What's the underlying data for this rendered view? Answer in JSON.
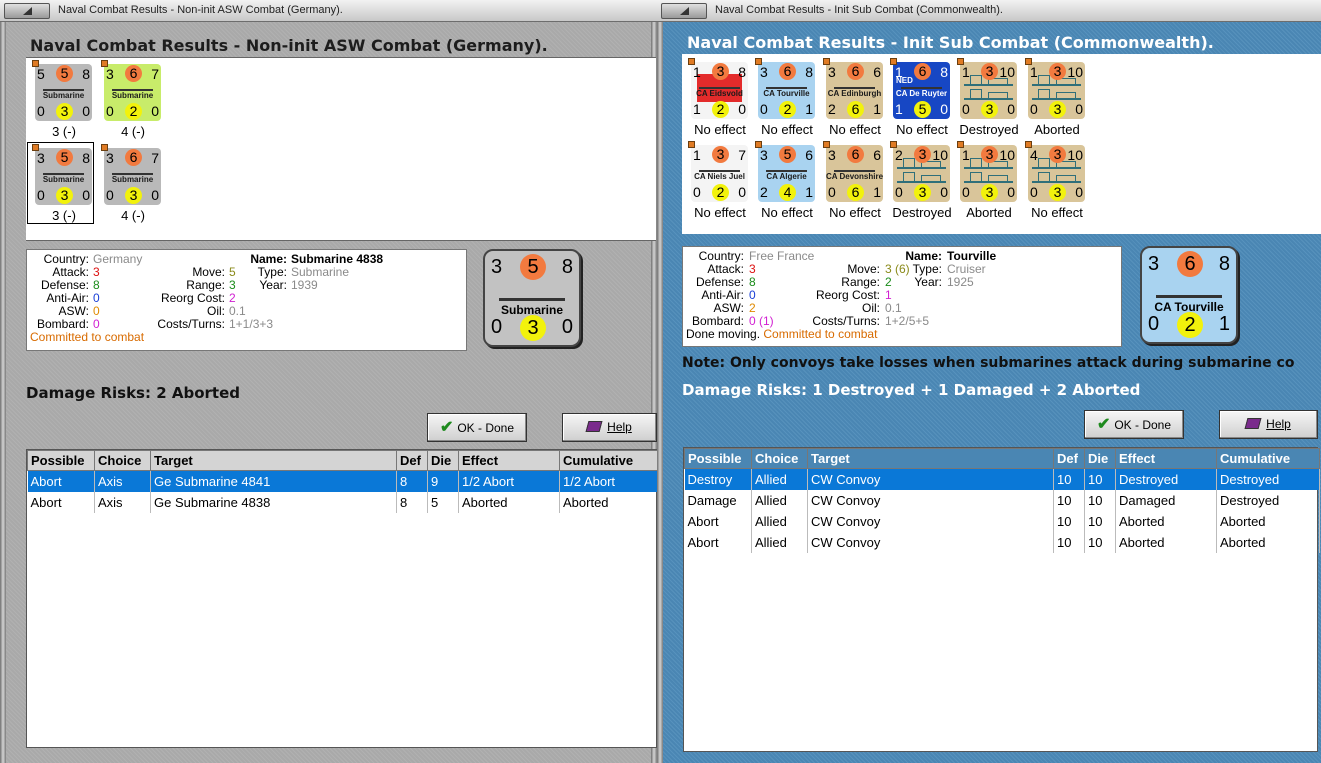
{
  "left": {
    "window_title": "Naval Combat Results - Non-init ASW Combat (Germany).",
    "heading": "Naval Combat Results - Non-init ASW Combat (Germany).",
    "units": [
      {
        "tl": "5",
        "tc": "5",
        "tr": "8",
        "name": "Submarine",
        "bl": "0",
        "bc": "3",
        "br": "0",
        "result": "3 (-)",
        "bg": "#b9b9b9"
      },
      {
        "tl": "3",
        "tc": "6",
        "tr": "7",
        "name": "Submarine",
        "bl": "0",
        "bc": "2",
        "br": "0",
        "result": "4 (-)",
        "bg": "#c8ec6a"
      },
      {
        "tl": "3",
        "tc": "5",
        "tr": "8",
        "name": "Submarine",
        "bl": "0",
        "bc": "3",
        "br": "0",
        "result": "3 (-)",
        "bg": "#b9b9b9"
      },
      {
        "tl": "3",
        "tc": "6",
        "tr": "7",
        "name": "Submarine",
        "bl": "0",
        "bc": "3",
        "br": "0",
        "result": "4 (-)",
        "bg": "#b9b9b9"
      }
    ],
    "info": {
      "country_label": "Country:",
      "country": "Germany",
      "attack_label": "Attack:",
      "attack": "3",
      "defense_label": "Defense:",
      "defense": "8",
      "antiair_label": "Anti-Air:",
      "antiair": "0",
      "asw_label": "ASW:",
      "asw": "0",
      "bombard_label": "Bombard:",
      "bombard": "0",
      "move_label": "Move:",
      "move": "5",
      "range_label": "Range:",
      "range": "3",
      "reorg_label": "Reorg Cost:",
      "reorg": "2",
      "oil_label": "Oil:",
      "oil": "0.1",
      "costs_label": "Costs/Turns:",
      "costs": "1+1/3+3",
      "name_label": "Name:",
      "name": "Submarine 4838",
      "type_label": "Type:",
      "type": "Submarine",
      "year_label": "Year:",
      "year": "1939",
      "status": "Committed to combat"
    },
    "big": {
      "tl": "3",
      "tc": "5",
      "tr": "8",
      "name": "Submarine",
      "bl": "0",
      "bc": "3",
      "br": "0"
    },
    "damage_risks": "Damage Risks:  2 Aborted",
    "ok_label": "OK - Done",
    "help_label": "Help",
    "columns": [
      "Possible",
      "Choice",
      "Target",
      "Def",
      "Die",
      "Effect",
      "Cumulative"
    ],
    "rows": [
      [
        "Abort",
        "Axis",
        "Ge Submarine 4841",
        "8",
        "9",
        "1/2 Abort",
        "1/2 Abort"
      ],
      [
        "Abort",
        "Axis",
        "Ge Submarine 4838",
        "8",
        "5",
        "Aborted",
        "Aborted"
      ]
    ]
  },
  "right": {
    "window_title": "Naval Combat Results - Init Sub Combat (Commonwealth).",
    "heading": "Naval Combat Results - Init Sub Combat (Commonwealth).",
    "units": [
      {
        "tl": "1",
        "tc": "3",
        "tr": "8",
        "name": "CA Eidsvold",
        "bl": "1",
        "bc": "2",
        "br": "0",
        "result": "No effect",
        "bg": "#f4f4f4",
        "special": "red"
      },
      {
        "tl": "3",
        "tc": "6",
        "tr": "8",
        "name": "CA Tourville",
        "bl": "0",
        "bc": "2",
        "br": "1",
        "result": "No effect",
        "bg": "#a9d3f0"
      },
      {
        "tl": "3",
        "tc": "6",
        "tr": "6",
        "name": "CA Edinburgh",
        "bl": "2",
        "bc": "6",
        "br": "1",
        "result": "No effect",
        "bg": "#d9c59a"
      },
      {
        "tl": "1",
        "tc": "6",
        "tr": "8",
        "name": "CA De Ruyter",
        "bl": "1",
        "bc": "5",
        "br": "0",
        "result": "No effect",
        "bg": "#1747c4",
        "nat": "NED"
      },
      {
        "tl": "1",
        "tc": "3",
        "tr": "10",
        "name": "",
        "bl": "0",
        "bc": "3",
        "br": "0",
        "result": "Destroyed",
        "bg": "#d9c59a",
        "convoy": true
      },
      {
        "tl": "1",
        "tc": "3",
        "tr": "10",
        "name": "",
        "bl": "0",
        "bc": "3",
        "br": "0",
        "result": "Aborted",
        "bg": "#d9c59a",
        "convoy": true
      },
      {
        "tl": "1",
        "tc": "3",
        "tr": "7",
        "name": "CA Niels Juel",
        "bl": "0",
        "bc": "2",
        "br": "0",
        "result": "No effect",
        "bg": "#f4f4f4"
      },
      {
        "tl": "3",
        "tc": "5",
        "tr": "6",
        "name": "CA Algerie",
        "bl": "2",
        "bc": "4",
        "br": "1",
        "result": "No effect",
        "bg": "#a9d3f0"
      },
      {
        "tl": "3",
        "tc": "6",
        "tr": "6",
        "name": "CA Devonshire",
        "bl": "0",
        "bc": "6",
        "br": "1",
        "result": "No effect",
        "bg": "#d9c59a"
      },
      {
        "tl": "2",
        "tc": "3",
        "tr": "10",
        "name": "",
        "bl": "0",
        "bc": "3",
        "br": "0",
        "result": "Destroyed",
        "bg": "#d9c59a",
        "convoy": true
      },
      {
        "tl": "1",
        "tc": "3",
        "tr": "10",
        "name": "",
        "bl": "0",
        "bc": "3",
        "br": "0",
        "result": "Aborted",
        "bg": "#d9c59a",
        "convoy": true
      },
      {
        "tl": "4",
        "tc": "3",
        "tr": "10",
        "name": "",
        "bl": "0",
        "bc": "3",
        "br": "0",
        "result": "No effect",
        "bg": "#d9c59a",
        "convoy": true
      }
    ],
    "info": {
      "country_label": "Country:",
      "country": "Free France",
      "attack_label": "Attack:",
      "attack": "3",
      "defense_label": "Defense:",
      "defense": "8",
      "antiair_label": "Anti-Air:",
      "antiair": "0",
      "asw_label": "ASW:",
      "asw": "2",
      "bombard_label": "Bombard:",
      "bombard": "0 (1)",
      "move_label": "Move:",
      "move": "3 (6)",
      "range_label": "Range:",
      "range": "2",
      "reorg_label": "Reorg Cost:",
      "reorg": "1",
      "oil_label": "Oil:",
      "oil": "0.1",
      "costs_label": "Costs/Turns:",
      "costs": "1+2/5+5",
      "name_label": "Name:",
      "name": "Tourville",
      "type_label": "Type:",
      "type": "Cruiser",
      "year_label": "Year:",
      "year": "1925",
      "status_prefix": "Done moving. ",
      "status": "Committed to combat"
    },
    "big": {
      "tl": "3",
      "tc": "6",
      "tr": "8",
      "name": "CA Tourville",
      "bl": "0",
      "bc": "2",
      "br": "1"
    },
    "note": "Note: Only convoys take losses when submarines attack during submarine co",
    "damage_risks": "Damage Risks:  1 Destroyed + 1 Damaged + 2 Aborted",
    "ok_label": "OK - Done",
    "help_label": "Help",
    "columns": [
      "Possible",
      "Choice",
      "Target",
      "Def",
      "Die",
      "Effect",
      "Cumulative"
    ],
    "rows": [
      [
        "Destroy",
        "Allied",
        "CW Convoy",
        "10",
        "10",
        "Destroyed",
        "Destroyed"
      ],
      [
        "Damage",
        "Allied",
        "CW Convoy",
        "10",
        "10",
        "Damaged",
        "Destroyed"
      ],
      [
        "Abort",
        "Allied",
        "CW Convoy",
        "10",
        "10",
        "Aborted",
        "Aborted"
      ],
      [
        "Abort",
        "Allied",
        "CW Convoy",
        "10",
        "10",
        "Aborted",
        "Aborted"
      ]
    ]
  }
}
